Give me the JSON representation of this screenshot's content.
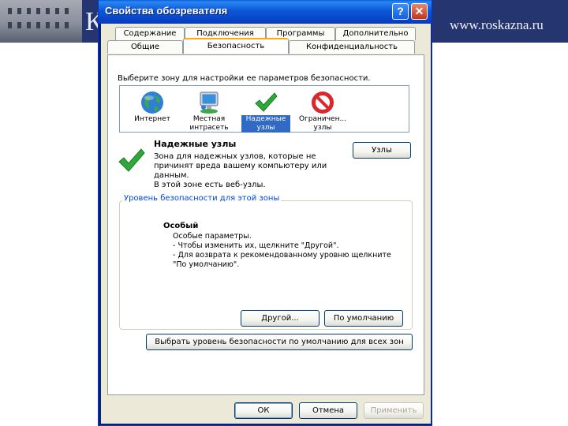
{
  "banner": {
    "letter": "К",
    "url": "www.roskazna.ru"
  },
  "dialog": {
    "title": "Свойства обозревателя",
    "help_label": "?",
    "close_label": "✕",
    "tabs_back": [
      "Содержание",
      "Подключения",
      "Программы",
      "Дополнительно"
    ],
    "tabs_front": [
      "Общие",
      "Безопасность",
      "Конфиденциальность"
    ],
    "zone_prompt": "Выберите зону для настройки ее параметров безопасности.",
    "zones": [
      {
        "label": "Интернет",
        "icon": "globe-icon"
      },
      {
        "label": "Местная интрасеть",
        "icon": "intranet-icon"
      },
      {
        "label": "Надежные узлы",
        "icon": "checkmark-icon",
        "selected": true
      },
      {
        "label": "Ограничен... узлы",
        "icon": "restricted-icon"
      }
    ],
    "zone_title": "Надежные узлы",
    "zone_desc": "Зона для надежных узлов, которые не\nпричинят вреда вашему компьютеру или\nданным.\nВ этой зоне есть веб-узлы.",
    "sites_button": "Узлы",
    "group_label": "Уровень безопасности для этой зоны",
    "level_title": "Особый",
    "level_desc": "Особые параметры.\n- Чтобы изменить их, щелкните \"Другой\".\n- Для возврата к рекомендованному уровню щелкните\n\"По умолчанию\".",
    "custom_button": "Другой...",
    "default_button": "По умолчанию",
    "reset_all_button": "Выбрать уровень безопасности по умолчанию для всех зон",
    "ok_button": "ОК",
    "cancel_button": "Отмена",
    "apply_button": "Применить"
  },
  "colors": {
    "title_bar": "#0b58d6",
    "selection": "#316ac5",
    "dialog_face": "#ece9d8"
  }
}
